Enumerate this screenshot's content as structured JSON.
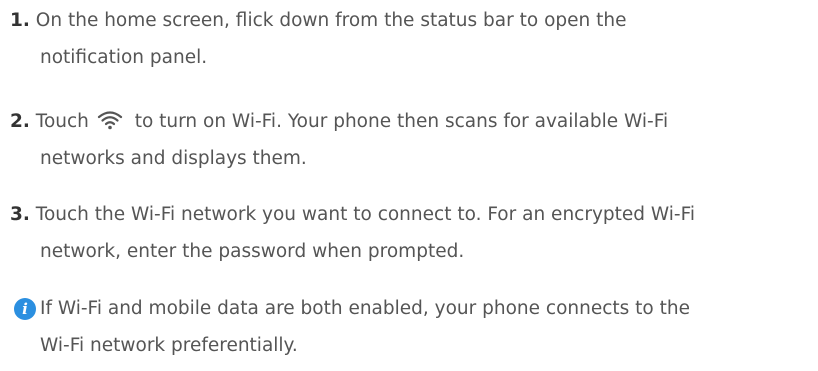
{
  "steps": [
    {
      "number": "1.",
      "line1": "On the home screen, flick down from the status bar to open the",
      "line2": "notification panel."
    },
    {
      "number": "2.",
      "pre": "Touch",
      "icon": "wifi-icon",
      "post": "to turn on Wi-Fi. Your phone then scans for available Wi-Fi",
      "line2": "networks and displays them."
    },
    {
      "number": "3.",
      "line1": "Touch the Wi-Fi network you want to connect to. For an encrypted Wi-Fi",
      "line2": "network, enter the password when prompted."
    }
  ],
  "note": {
    "icon": "info-icon",
    "icon_glyph": "i",
    "icon_color": "#2b8fe0",
    "line1": "If Wi-Fi and mobile data are both enabled, your phone connects to the",
    "line2": "Wi-Fi network preferentially."
  }
}
